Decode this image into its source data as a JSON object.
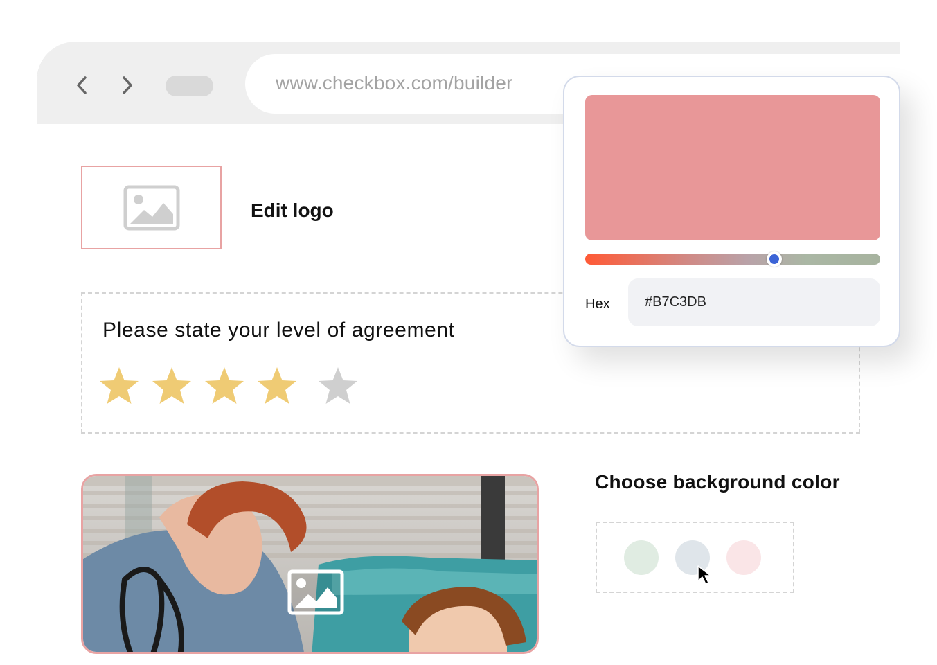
{
  "browser": {
    "url": "www.checkbox.com/builder",
    "back_icon": "chevron-left-icon",
    "forward_icon": "chevron-right-icon"
  },
  "logo": {
    "label": "Edit logo",
    "icon": "image-icon"
  },
  "rating": {
    "question": "Please state your level of agreement",
    "value": 4,
    "max": 5,
    "filled_color": "#EFCB74",
    "empty_color": "#CFCFCF"
  },
  "background": {
    "title": "Choose background color",
    "swatches": [
      "#E0ECE2",
      "#DFE5EA",
      "#FAE5E7"
    ]
  },
  "color_picker": {
    "preview_color": "#E89798",
    "hue_position": 0.64,
    "thumb_color": "#3B63D6",
    "hex_label": "Hex",
    "hex_value": "#B7C3DB"
  },
  "colors": {
    "accent_border": "#E8A3A3",
    "chrome_bg": "#EFEFEF"
  }
}
